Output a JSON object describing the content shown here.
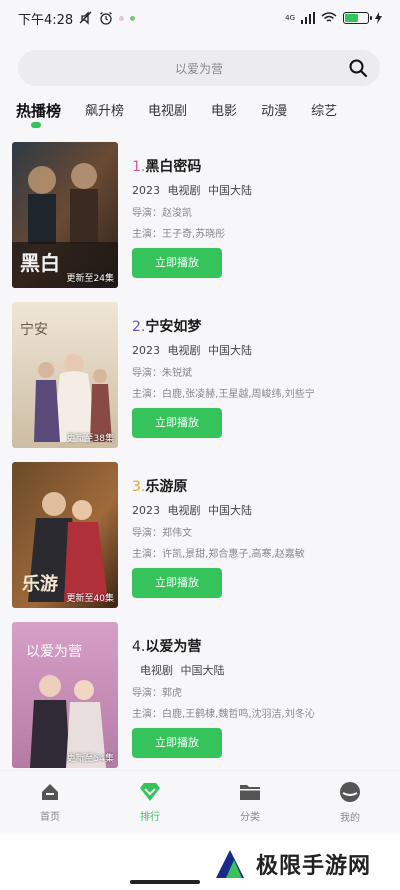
{
  "status_bar": {
    "time": "下午4:28",
    "battery_level": 0.6,
    "network": "4G"
  },
  "search": {
    "placeholder": "以爱为营"
  },
  "tabs": [
    {
      "label": "热播榜",
      "active": true
    },
    {
      "label": "飙升榜",
      "active": false
    },
    {
      "label": "电视剧",
      "active": false
    },
    {
      "label": "电影",
      "active": false
    },
    {
      "label": "动漫",
      "active": false
    },
    {
      "label": "综艺",
      "active": false
    }
  ],
  "items": [
    {
      "rank": "1.",
      "title": "黑白密码",
      "year": "2023",
      "type": "电视剧",
      "region": "中国大陆",
      "director": "导演：赵浚凯",
      "cast": "主演：王子奇,苏晓彤",
      "update": "更新至24集",
      "button": "立即播放"
    },
    {
      "rank": "2.",
      "title": "宁安如梦",
      "year": "2023",
      "type": "电视剧",
      "region": "中国大陆",
      "director": "导演：朱锐斌",
      "cast": "主演：白鹿,张凌赫,王星越,周峻纬,刘些宁",
      "update": "更新至38集",
      "button": "立即播放"
    },
    {
      "rank": "3.",
      "title": "乐游原",
      "year": "2023",
      "type": "电视剧",
      "region": "中国大陆",
      "director": "导演：郑伟文",
      "cast": "主演：许凯,景甜,郑合惠子,高寒,赵嘉敏",
      "update": "更新至40集",
      "button": "立即播放"
    },
    {
      "rank": "4.",
      "title": "以爱为营",
      "year": "",
      "type": "电视剧",
      "region": "中国大陆",
      "director": "导演：郭虎",
      "cast": "主演：白鹿,王鹤棣,魏哲鸣,沈羽洁,刘冬沁",
      "update": "更新至54集",
      "button": "立即播放"
    }
  ],
  "bottom_nav": [
    {
      "label": "首页",
      "icon": "home-icon",
      "active": false
    },
    {
      "label": "排行",
      "icon": "ranking-icon",
      "active": true
    },
    {
      "label": "分类",
      "icon": "folder-icon",
      "active": false
    },
    {
      "label": "我的",
      "icon": "profile-icon",
      "active": false
    }
  ],
  "watermark": {
    "text": "极限手游网"
  },
  "colors": {
    "accent": "#36c35c",
    "rank1": "#e0559a",
    "rank2": "#6a4fcf",
    "rank3": "#e4a03b"
  }
}
